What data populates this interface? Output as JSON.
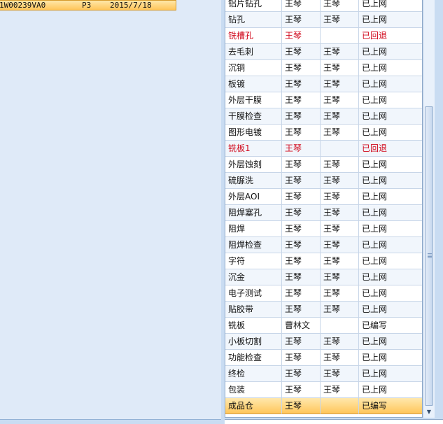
{
  "left_panel": {
    "selected_row": {
      "code": "1W00239VA0",
      "level": "P3",
      "date": "2015/7/18"
    }
  },
  "process_grid": {
    "rows": [
      {
        "step": "铝片钻孔",
        "operator": "王琴",
        "reviewer": "王琴",
        "status": "已上网"
      },
      {
        "step": "钻孔",
        "operator": "王琴",
        "reviewer": "王琴",
        "status": "已上网"
      },
      {
        "step": "铣槽孔",
        "operator": "王琴",
        "reviewer": "",
        "status": "已回退"
      },
      {
        "step": "去毛刺",
        "operator": "王琴",
        "reviewer": "王琴",
        "status": "已上网"
      },
      {
        "step": "沉铜",
        "operator": "王琴",
        "reviewer": "王琴",
        "status": "已上网"
      },
      {
        "step": "板镀",
        "operator": "王琴",
        "reviewer": "王琴",
        "status": "已上网"
      },
      {
        "step": "外层干膜",
        "operator": "王琴",
        "reviewer": "王琴",
        "status": "已上网"
      },
      {
        "step": "干膜检查",
        "operator": "王琴",
        "reviewer": "王琴",
        "status": "已上网"
      },
      {
        "step": "图形电镀",
        "operator": "王琴",
        "reviewer": "王琴",
        "status": "已上网"
      },
      {
        "step": "铣板1",
        "operator": "王琴",
        "reviewer": "",
        "status": "已回退"
      },
      {
        "step": "外层蚀刻",
        "operator": "王琴",
        "reviewer": "王琴",
        "status": "已上网"
      },
      {
        "step": "硫脲洗",
        "operator": "王琴",
        "reviewer": "王琴",
        "status": "已上网"
      },
      {
        "step": "外层AOI",
        "operator": "王琴",
        "reviewer": "王琴",
        "status": "已上网"
      },
      {
        "step": "阻焊塞孔",
        "operator": "王琴",
        "reviewer": "王琴",
        "status": "已上网"
      },
      {
        "step": "阻焊",
        "operator": "王琴",
        "reviewer": "王琴",
        "status": "已上网"
      },
      {
        "step": "阻焊检查",
        "operator": "王琴",
        "reviewer": "王琴",
        "status": "已上网"
      },
      {
        "step": "字符",
        "operator": "王琴",
        "reviewer": "王琴",
        "status": "已上网"
      },
      {
        "step": "沉金",
        "operator": "王琴",
        "reviewer": "王琴",
        "status": "已上网"
      },
      {
        "step": "电子测试",
        "operator": "王琴",
        "reviewer": "王琴",
        "status": "已上网"
      },
      {
        "step": "贴胶带",
        "operator": "王琴",
        "reviewer": "王琴",
        "status": "已上网"
      },
      {
        "step": "铣板",
        "operator": "曹林文",
        "reviewer": "",
        "status": "已编写"
      },
      {
        "step": "小板切割",
        "operator": "王琴",
        "reviewer": "王琴",
        "status": "已上网"
      },
      {
        "step": "功能检查",
        "operator": "王琴",
        "reviewer": "王琴",
        "status": "已上网"
      },
      {
        "step": "终检",
        "operator": "王琴",
        "reviewer": "王琴",
        "status": "已上网"
      },
      {
        "step": "包装",
        "operator": "王琴",
        "reviewer": "王琴",
        "status": "已上网"
      },
      {
        "step": "成品仓",
        "operator": "王琴",
        "reviewer": "",
        "status": "已编写"
      }
    ],
    "selected_index": 25,
    "returned_color": "#d1091c",
    "selection_color": "#ffc65a"
  }
}
